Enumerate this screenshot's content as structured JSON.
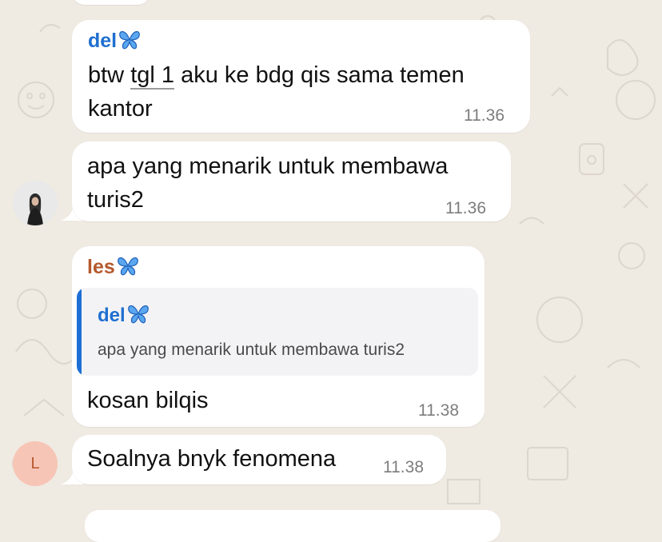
{
  "colors": {
    "background": "#efeae2",
    "bubble": "#ffffff",
    "sender_del": "#1f6fd0",
    "sender_les": "#b5582d",
    "quote_bar": "#1d6fd6",
    "avatar_L_bg": "#f7c5b6",
    "avatar_L_text": "#b5582d"
  },
  "messages": [
    {
      "sender": "del",
      "sender_emoji_icon": "butterfly-icon",
      "text_prefix": "btw ",
      "text_underlined": "tgl 1",
      "text_suffix": " aku ke bdg qis sama temen",
      "text_line2": "kantor",
      "time": "11.36"
    },
    {
      "text_line1": "apa yang menarik untuk membawa",
      "text_line2": "turis2",
      "time": "11.36",
      "avatar_icon": "profile-photo-avatar"
    },
    {
      "sender": "les",
      "sender_emoji_icon": "butterfly-icon",
      "quote_sender": "del",
      "quote_text": "apa yang menarik untuk membawa turis2",
      "text": "kosan bilqis",
      "time": "11.38"
    },
    {
      "avatar_letter": "L",
      "text": "Soalnya bnyk fenomena",
      "time": "11.38"
    }
  ]
}
